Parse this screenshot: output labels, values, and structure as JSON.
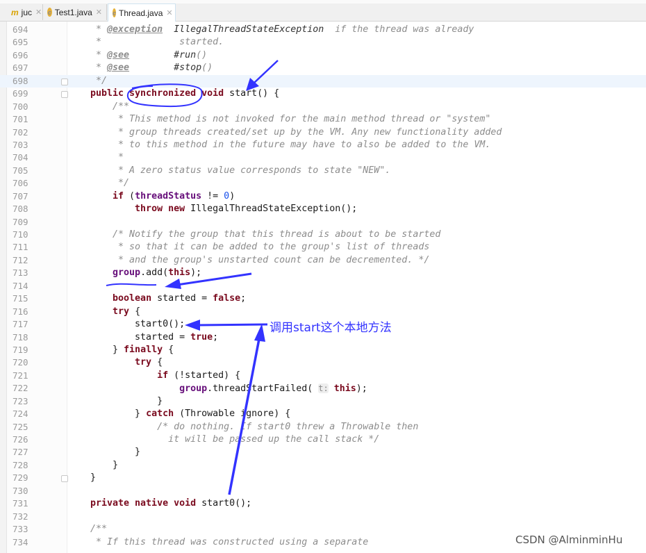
{
  "tabs": [
    {
      "label": "juc",
      "icon": "module-icon",
      "active": false
    },
    {
      "label": "Test1.java",
      "icon": "class-icon",
      "active": false
    },
    {
      "label": "Thread.java",
      "icon": "class-icon",
      "active": true
    }
  ],
  "highlighted_line": "698",
  "lines": [
    {
      "n": "694",
      "t": [
        [
          " * ",
          "c"
        ],
        [
          "@exception",
          "ct"
        ],
        [
          "  ",
          "c"
        ],
        [
          "IllegalThreadStateException",
          "cd"
        ],
        [
          "  if the thread was already",
          "c"
        ]
      ]
    },
    {
      "n": "695",
      "t": [
        [
          " *              started.",
          "c"
        ]
      ]
    },
    {
      "n": "696",
      "t": [
        [
          " * ",
          "c"
        ],
        [
          "@see",
          "ct"
        ],
        [
          "        ",
          "c"
        ],
        [
          "#run",
          "cd"
        ],
        [
          "()",
          "c"
        ]
      ]
    },
    {
      "n": "697",
      "t": [
        [
          " * ",
          "c"
        ],
        [
          "@see",
          "ct"
        ],
        [
          "        ",
          "c"
        ],
        [
          "#stop",
          "cd"
        ],
        [
          "()",
          "c"
        ]
      ]
    },
    {
      "n": "698",
      "t": [
        [
          " */",
          "c"
        ]
      ]
    },
    {
      "n": "699",
      "t": [
        [
          "public synchronized void ",
          "k"
        ],
        [
          "start() {",
          ""
        ]
      ]
    },
    {
      "n": "700",
      "t": [
        [
          "    /**",
          "c"
        ]
      ]
    },
    {
      "n": "701",
      "t": [
        [
          "     * This method is not invoked for the main method thread or \"system\"",
          "c"
        ]
      ]
    },
    {
      "n": "702",
      "t": [
        [
          "     * group threads created/set up by the VM. Any new functionality added",
          "c"
        ]
      ]
    },
    {
      "n": "703",
      "t": [
        [
          "     * to this method in the future may have to also be added to the VM.",
          "c"
        ]
      ]
    },
    {
      "n": "704",
      "t": [
        [
          "     *",
          "c"
        ]
      ]
    },
    {
      "n": "705",
      "t": [
        [
          "     * A zero status value corresponds to state \"NEW\".",
          "c"
        ]
      ]
    },
    {
      "n": "706",
      "t": [
        [
          "     */",
          "c"
        ]
      ]
    },
    {
      "n": "707",
      "t": [
        [
          "    ",
          ""
        ],
        [
          "if",
          "k"
        ],
        [
          " (",
          ""
        ],
        [
          "threadStatus",
          "f"
        ],
        [
          " != ",
          ""
        ],
        [
          "0",
          "n"
        ],
        [
          ")",
          ""
        ]
      ]
    },
    {
      "n": "708",
      "t": [
        [
          "        ",
          ""
        ],
        [
          "throw new ",
          "k"
        ],
        [
          "IllegalThreadStateException();",
          ""
        ]
      ]
    },
    {
      "n": "709",
      "t": []
    },
    {
      "n": "710",
      "t": [
        [
          "    /* Notify the group that this thread is about to be started",
          "c"
        ]
      ]
    },
    {
      "n": "711",
      "t": [
        [
          "     * so that it can be added to the group's list of threads",
          "c"
        ]
      ]
    },
    {
      "n": "712",
      "t": [
        [
          "     * and the group's unstarted count can be decremented. */",
          "c"
        ]
      ]
    },
    {
      "n": "713",
      "t": [
        [
          "    ",
          ""
        ],
        [
          "group",
          "f"
        ],
        [
          ".add(",
          ""
        ],
        [
          "this",
          "k"
        ],
        [
          ");",
          ""
        ]
      ]
    },
    {
      "n": "714",
      "t": []
    },
    {
      "n": "715",
      "t": [
        [
          "    ",
          ""
        ],
        [
          "boolean",
          "k"
        ],
        [
          " started = ",
          ""
        ],
        [
          "false",
          "k"
        ],
        [
          ";",
          ""
        ]
      ]
    },
    {
      "n": "716",
      "t": [
        [
          "    ",
          ""
        ],
        [
          "try",
          "k"
        ],
        [
          " {",
          ""
        ]
      ]
    },
    {
      "n": "717",
      "t": [
        [
          "        start0();",
          ""
        ]
      ]
    },
    {
      "n": "718",
      "t": [
        [
          "        started = ",
          ""
        ],
        [
          "true",
          "k"
        ],
        [
          ";",
          ""
        ]
      ]
    },
    {
      "n": "719",
      "t": [
        [
          "    } ",
          ""
        ],
        [
          "finally",
          "k"
        ],
        [
          " {",
          ""
        ]
      ]
    },
    {
      "n": "720",
      "t": [
        [
          "        ",
          ""
        ],
        [
          "try",
          "k"
        ],
        [
          " {",
          ""
        ]
      ]
    },
    {
      "n": "721",
      "t": [
        [
          "            ",
          ""
        ],
        [
          "if",
          "k"
        ],
        [
          " (!started) {",
          ""
        ]
      ]
    },
    {
      "n": "722",
      "t": [
        [
          "                ",
          ""
        ],
        [
          "group",
          "f"
        ],
        [
          ".threadStartFailed( ",
          ""
        ],
        [
          "t:",
          "h"
        ],
        [
          " ",
          ""
        ],
        [
          "this",
          "k"
        ],
        [
          ");",
          ""
        ]
      ]
    },
    {
      "n": "723",
      "t": [
        [
          "            }",
          ""
        ]
      ]
    },
    {
      "n": "724",
      "t": [
        [
          "        } ",
          ""
        ],
        [
          "catch",
          "k"
        ],
        [
          " (Throwable ignore) {",
          ""
        ]
      ]
    },
    {
      "n": "725",
      "t": [
        [
          "            /* do nothing. If start0 threw a Throwable then",
          "c"
        ]
      ]
    },
    {
      "n": "726",
      "t": [
        [
          "              it will be passed up the call stack */",
          "c"
        ]
      ]
    },
    {
      "n": "727",
      "t": [
        [
          "        }",
          ""
        ]
      ]
    },
    {
      "n": "728",
      "t": [
        [
          "    }",
          ""
        ]
      ]
    },
    {
      "n": "729",
      "t": [
        [
          "}",
          ""
        ]
      ]
    },
    {
      "n": "730",
      "t": []
    },
    {
      "n": "731",
      "t": [
        [
          "private native void ",
          "k"
        ],
        [
          "start0();",
          ""
        ]
      ]
    },
    {
      "n": "732",
      "t": []
    },
    {
      "n": "733",
      "t": [
        [
          "/**",
          "c"
        ]
      ]
    },
    {
      "n": "734",
      "t": [
        [
          " * If this thread was constructed using a separate",
          "c"
        ]
      ]
    }
  ],
  "annotation": {
    "note": "调用start这个本地方法",
    "color": "#3333ff"
  },
  "watermark": "CSDN @AlminminHu"
}
